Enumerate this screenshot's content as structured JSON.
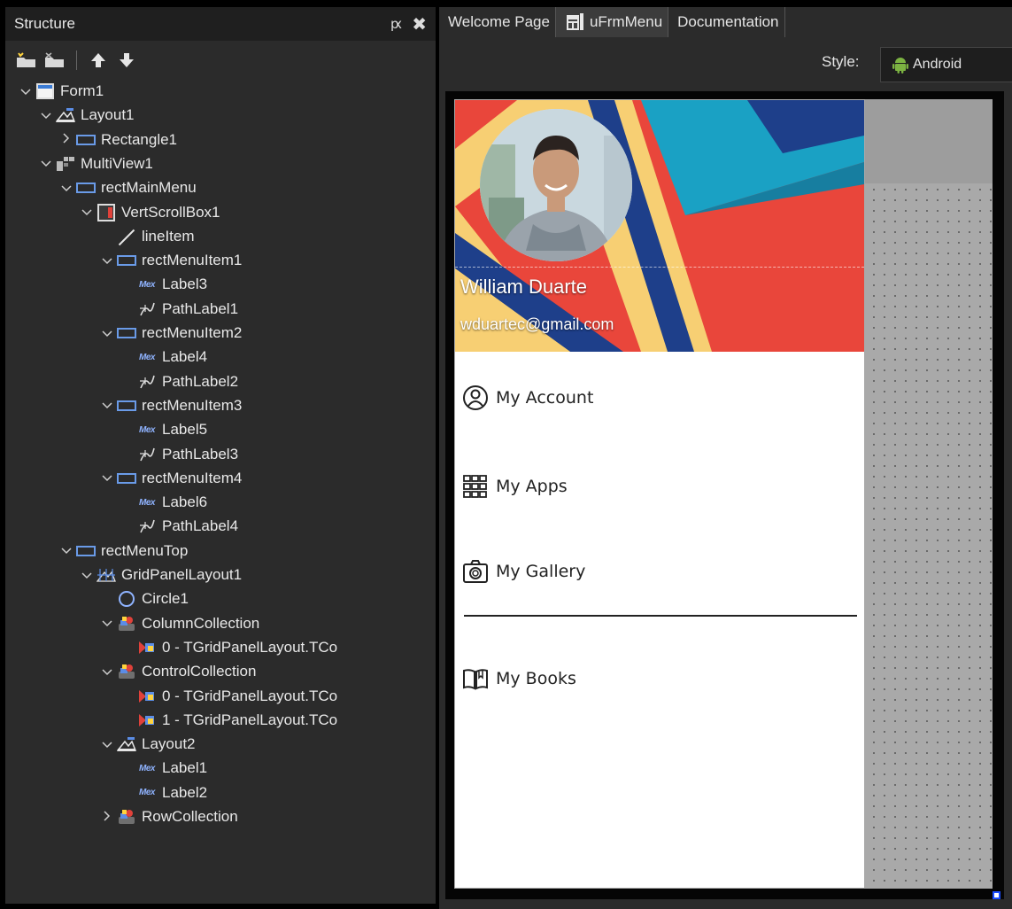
{
  "structure": {
    "title": "Structure",
    "pin_glyph": "ԗ",
    "close_glyph": "✖",
    "toolbar": [
      "new-item-icon",
      "delete-item-icon",
      "move-up-icon",
      "move-down-icon"
    ],
    "tree": [
      {
        "label": "Form1",
        "icon": "form",
        "depth": 0,
        "chev": "v"
      },
      {
        "label": "Layout1",
        "icon": "layout",
        "depth": 1,
        "chev": "v"
      },
      {
        "label": "Rectangle1",
        "icon": "rect",
        "depth": 2,
        "chev": ">"
      },
      {
        "label": "MultiView1",
        "icon": "multi",
        "depth": 1,
        "chev": "v"
      },
      {
        "label": "rectMainMenu",
        "icon": "rect",
        "depth": 2,
        "chev": "v"
      },
      {
        "label": "VertScrollBox1",
        "icon": "vscroll",
        "depth": 3,
        "chev": "v"
      },
      {
        "label": "lineItem",
        "icon": "line",
        "depth": 4,
        "chev": ""
      },
      {
        "label": "rectMenuItem1",
        "icon": "rect",
        "depth": 4,
        "chev": "v"
      },
      {
        "label": "Label3",
        "icon": "label",
        "depth": 5,
        "chev": ""
      },
      {
        "label": "PathLabel1",
        "icon": "path",
        "depth": 5,
        "chev": ""
      },
      {
        "label": "rectMenuItem2",
        "icon": "rect",
        "depth": 4,
        "chev": "v"
      },
      {
        "label": "Label4",
        "icon": "label",
        "depth": 5,
        "chev": ""
      },
      {
        "label": "PathLabel2",
        "icon": "path",
        "depth": 5,
        "chev": ""
      },
      {
        "label": "rectMenuItem3",
        "icon": "rect",
        "depth": 4,
        "chev": "v"
      },
      {
        "label": "Label5",
        "icon": "label",
        "depth": 5,
        "chev": ""
      },
      {
        "label": "PathLabel3",
        "icon": "path",
        "depth": 5,
        "chev": ""
      },
      {
        "label": "rectMenuItem4",
        "icon": "rect",
        "depth": 4,
        "chev": "v"
      },
      {
        "label": "Label6",
        "icon": "label",
        "depth": 5,
        "chev": ""
      },
      {
        "label": "PathLabel4",
        "icon": "path",
        "depth": 5,
        "chev": ""
      },
      {
        "label": "rectMenuTop",
        "icon": "rect",
        "depth": 2,
        "chev": "v"
      },
      {
        "label": "GridPanelLayout1",
        "icon": "grid",
        "depth": 3,
        "chev": "v"
      },
      {
        "label": "Circle1",
        "icon": "circle",
        "depth": 4,
        "chev": ""
      },
      {
        "label": "ColumnCollection",
        "icon": "coll",
        "depth": 4,
        "chev": "v"
      },
      {
        "label": "0 - TGridPanelLayout.TCo",
        "icon": "item",
        "depth": 5,
        "chev": ""
      },
      {
        "label": "ControlCollection",
        "icon": "coll",
        "depth": 4,
        "chev": "v"
      },
      {
        "label": "0 - TGridPanelLayout.TCo",
        "icon": "item",
        "depth": 5,
        "chev": ""
      },
      {
        "label": "1 - TGridPanelLayout.TCo",
        "icon": "item",
        "depth": 5,
        "chev": ""
      },
      {
        "label": "Layout2",
        "icon": "layout",
        "depth": 4,
        "chev": "v"
      },
      {
        "label": "Label1",
        "icon": "label",
        "depth": 5,
        "chev": ""
      },
      {
        "label": "Label2",
        "icon": "label",
        "depth": 5,
        "chev": ""
      },
      {
        "label": "RowCollection",
        "icon": "coll",
        "depth": 4,
        "chev": ">"
      }
    ]
  },
  "tabs": [
    {
      "label": "Welcome Page",
      "active": false
    },
    {
      "label": "uFrmMenu",
      "active": true
    },
    {
      "label": "Documentation",
      "active": false
    }
  ],
  "style_bar": {
    "label": "Style:",
    "value": "Android"
  },
  "preview": {
    "user_name": "William Duarte",
    "user_email": "wduartec@gmail.com",
    "menu_items": [
      {
        "label": "My Account",
        "icon": "account-circle-icon"
      },
      {
        "label": "My Apps",
        "icon": "apps-grid-icon"
      },
      {
        "label": "My Gallery",
        "icon": "camera-icon"
      },
      {
        "label": "My Books",
        "icon": "book-icon"
      }
    ]
  },
  "colors": {
    "panel_bg": "#2b2b2b",
    "accent_blue": "#1a4dff",
    "header_red": "#e9463b",
    "header_teal": "#1aa1c4",
    "header_navy": "#1e3f8a",
    "header_yellow": "#f7cf73"
  }
}
